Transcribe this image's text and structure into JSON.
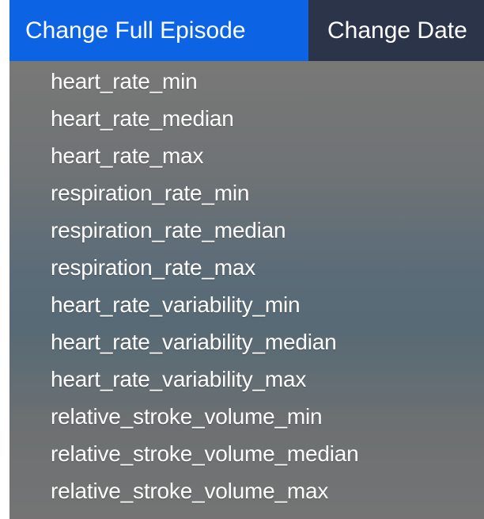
{
  "menubar": {
    "items": [
      {
        "label": "Change Full Episode",
        "active": true
      },
      {
        "label": "Change Date",
        "active": false
      }
    ],
    "active_color": "#0c63e4",
    "background_color": "#2b3448"
  },
  "dropdown": {
    "items": [
      {
        "label": "heart_rate_min"
      },
      {
        "label": "heart_rate_median"
      },
      {
        "label": "heart_rate_max"
      },
      {
        "label": "respiration_rate_min"
      },
      {
        "label": "respiration_rate_median"
      },
      {
        "label": "respiration_rate_max"
      },
      {
        "label": "heart_rate_variability_min"
      },
      {
        "label": "heart_rate_variability_median"
      },
      {
        "label": "heart_rate_variability_max"
      },
      {
        "label": "relative_stroke_volume_min"
      },
      {
        "label": "relative_stroke_volume_median"
      },
      {
        "label": "relative_stroke_volume_max"
      }
    ]
  }
}
